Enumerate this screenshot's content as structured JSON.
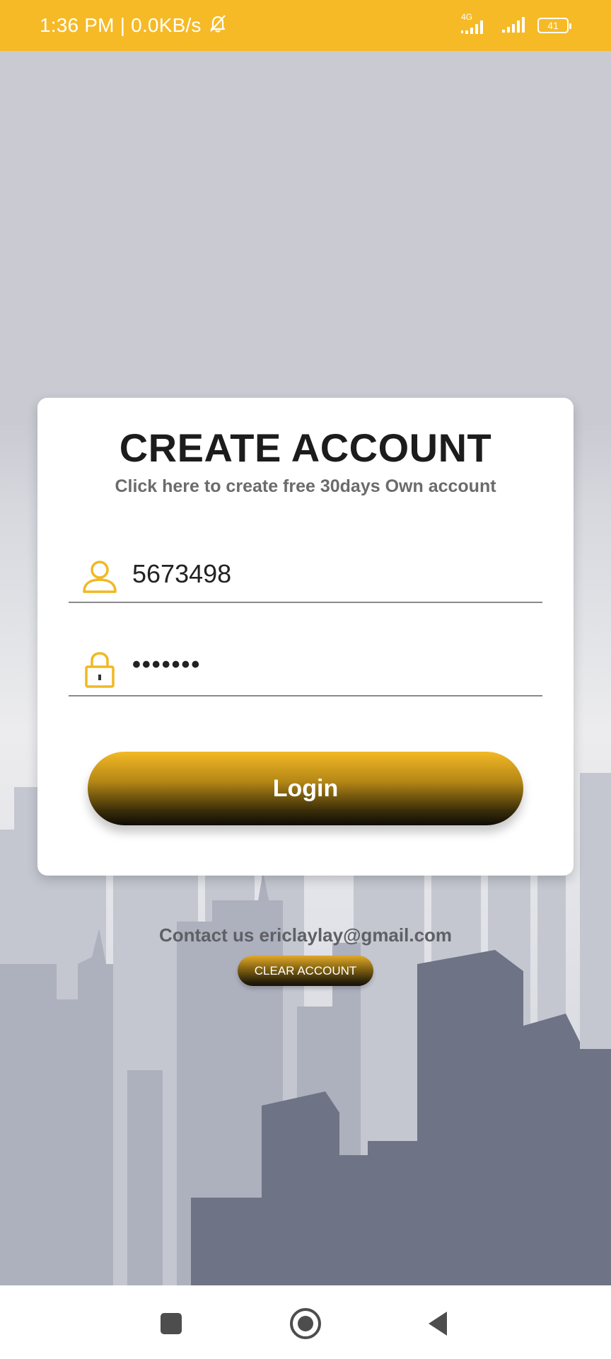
{
  "status_bar": {
    "time": "1:36 PM",
    "network_speed": "0.0KB/s",
    "network_type": "4G",
    "battery": "41",
    "icons": [
      "mute-bell-icon",
      "signal-4g-icon",
      "signal-icon",
      "battery-icon"
    ]
  },
  "card": {
    "title": "CREATE ACCOUNT",
    "subtitle": "Click here to create free 30days Own account",
    "username": {
      "icon": "user-icon",
      "value": "5673498"
    },
    "password": {
      "icon": "lock-icon",
      "value": "•••••••"
    },
    "login_label": "Login"
  },
  "footer": {
    "contact_text": "Contact us ericlaylay@gmail.com",
    "clear_label": "CLEAR ACCOUNT"
  },
  "nav_bar": {
    "icons": [
      "recents-icon",
      "home-icon",
      "back-icon"
    ]
  },
  "colors": {
    "accent": "#f6ba27",
    "card_bg": "#ffffff",
    "background": "#cbcbd3"
  }
}
